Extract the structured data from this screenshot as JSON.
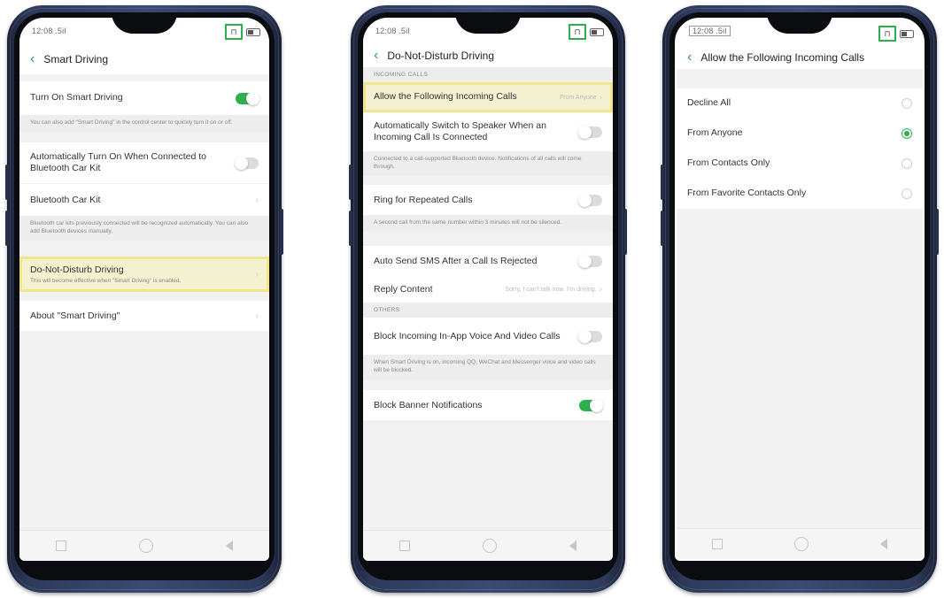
{
  "accent": "#2fb050",
  "highlight": "#f0e68c",
  "phone1": {
    "status_time": "12:08 .5il",
    "title": "Smart Driving",
    "rows": [
      {
        "label": "Turn On Smart Driving",
        "toggle": "on"
      },
      {
        "desc": "You can also add \"Smart Driving\" in the control center to quickly turn it on or off."
      },
      {
        "label": "Automatically Turn On When Connected to Bluetooth Car Kit",
        "toggle": "off"
      },
      {
        "label": "Bluetooth Car Kit"
      },
      {
        "desc": "Bluetooth car kits previously connected will be recognized automatically. You can also add Bluetooth devices manually."
      },
      {
        "label": "Do-Not-Disturb Driving",
        "sub": "This will become effective when \"Smart Driving\" is enabled."
      },
      {
        "label": "About \"Smart Driving\""
      }
    ]
  },
  "phone2": {
    "status_time": "12:08 .5il",
    "title": "Do-Not-Disturb Driving",
    "section_incoming": "INCOMING CALLS",
    "allow_label": "Allow the Following Incoming Calls",
    "allow_value": "From Anyone",
    "speaker_label": "Automatically Switch to Speaker When an Incoming Call Is Connected",
    "speaker_desc": "Connected to a call-supported Bluetooth device. Notifications of all calls will come through.",
    "repeat_label": "Ring for Repeated Calls",
    "repeat_desc": "A second call from the same number within 3 minutes will not be silenced.",
    "sms_label": "Auto Send SMS After a Call Is Rejected",
    "reply_label": "Reply Content",
    "reply_value": "Sorry, I can't talk now. I'm driving.",
    "section_others": "OTHERS",
    "block_label": "Block Incoming In-App Voice And Video Calls",
    "block_desc": "When Smart Driving is on, incoming QQ, WeChat and Messenger voice and video calls will be blocked.",
    "banner_label": "Block Banner Notifications"
  },
  "phone3": {
    "status_time": "12:08 .5il",
    "title": "Allow the Following Incoming Calls",
    "options": [
      {
        "label": "Decline All",
        "selected": false
      },
      {
        "label": "From Anyone",
        "selected": true
      },
      {
        "label": "From Contacts Only",
        "selected": false
      },
      {
        "label": "From Favorite Contacts Only",
        "selected": false
      }
    ]
  }
}
